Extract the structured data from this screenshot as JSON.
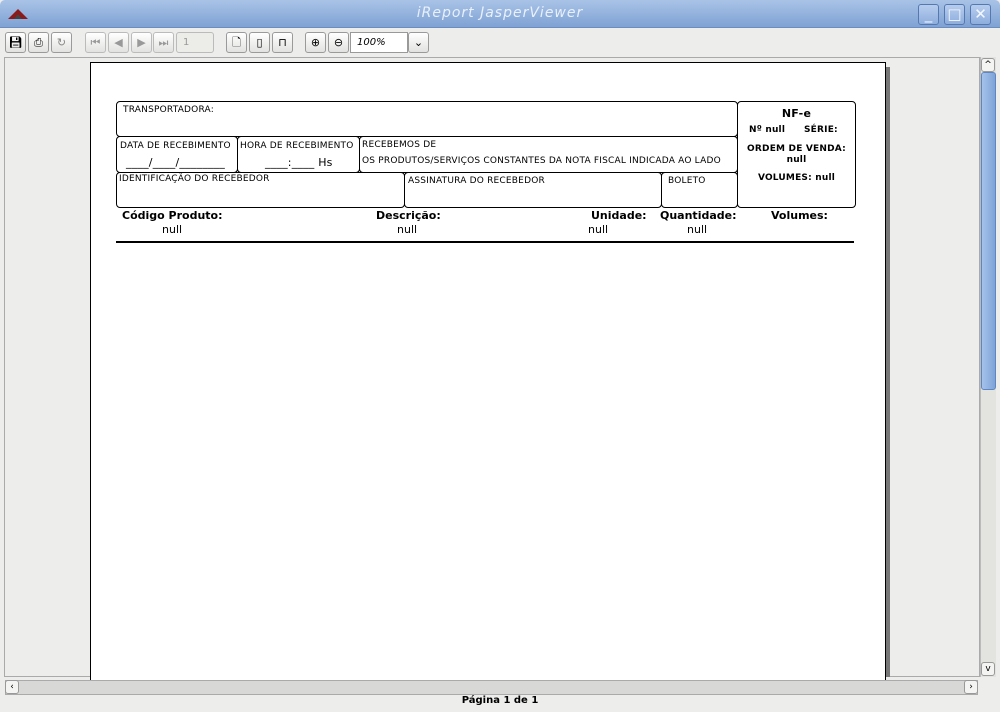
{
  "window": {
    "title": "iReport JasperViewer",
    "minimize": "_",
    "maximize": "□",
    "close": "✕"
  },
  "toolbar": {
    "save": "save-icon",
    "print": "print-icon",
    "reload": "reload-icon",
    "first": "⏮",
    "prev": "◀",
    "next": "▶",
    "last": "⏭",
    "page_value": "1",
    "zoom_value": "100%",
    "zoom_arrow": "⌄"
  },
  "report": {
    "transportadora": "TRANSPORTADORA:",
    "data_recebimento": "DATA DE RECEBIMENTO",
    "data_blank": "____/____/________",
    "hora_recebimento": "HORA DE RECEBIMENTO",
    "hora_blank": "____:____ Hs",
    "recebemos_de": "RECEBEMOS DE",
    "recebemos_text": "OS PRODUTOS/SERVIÇOS CONSTANTES DA NOTA FISCAL INDICADA AO LADO",
    "identificacao": "IDENTIFICAÇÃO DO RECEBEDOR",
    "assinatura": "ASSINATURA DO RECEBEDOR",
    "boleto": "BOLETO",
    "nfe": {
      "title": "NF-e",
      "numero": "Nº null",
      "serie": "SÉRIE:",
      "ordem_label": "ORDEM DE VENDA:",
      "ordem_value": "null",
      "volumes": "VOLUMES: null"
    },
    "columns": [
      "Código Produto:",
      "Descrição:",
      "Unidade:",
      "Quantidade:",
      "Volumes:"
    ],
    "row": [
      "null",
      "null",
      "null",
      "null"
    ]
  },
  "status": "Página 1 de 1"
}
